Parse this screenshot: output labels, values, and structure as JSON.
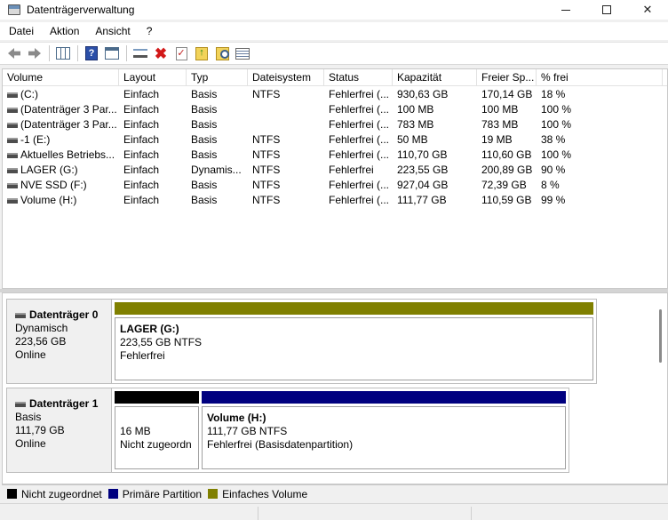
{
  "window": {
    "title": "Datenträgerverwaltung",
    "minimize": "—",
    "maximize": "",
    "close": "✕"
  },
  "menu": [
    "Datei",
    "Aktion",
    "Ansicht",
    "?"
  ],
  "toolbar": {
    "icons": [
      "back-icon",
      "forward-icon",
      "console-tree-icon",
      "help-icon",
      "show-hide-panel-icon",
      "connect-icon",
      "delete-icon",
      "checkmark-icon",
      "up-folder-icon",
      "search-icon",
      "properties-icon"
    ],
    "help_glyph": "?",
    "delete_glyph": "✖",
    "check_glyph": "✓",
    "up_glyph": "↑"
  },
  "volume_table": {
    "columns": [
      "Volume",
      "Layout",
      "Typ",
      "Dateisystem",
      "Status",
      "Kapazität",
      "Freier Sp...",
      "% frei"
    ],
    "rows": [
      [
        "(C:)",
        "Einfach",
        "Basis",
        "NTFS",
        "Fehlerfrei (...",
        "930,63 GB",
        "170,14 GB",
        "18 %"
      ],
      [
        "(Datenträger 3 Par...",
        "Einfach",
        "Basis",
        "",
        "Fehlerfrei (...",
        "100 MB",
        "100 MB",
        "100 %"
      ],
      [
        "(Datenträger 3 Par...",
        "Einfach",
        "Basis",
        "",
        "Fehlerfrei (...",
        "783 MB",
        "783 MB",
        "100 %"
      ],
      [
        "-1 (E:)",
        "Einfach",
        "Basis",
        "NTFS",
        "Fehlerfrei (...",
        "50 MB",
        "19 MB",
        "38 %"
      ],
      [
        "Aktuelles Betriebs...",
        "Einfach",
        "Basis",
        "NTFS",
        "Fehlerfrei (...",
        "110,70 GB",
        "110,60 GB",
        "100 %"
      ],
      [
        "LAGER (G:)",
        "Einfach",
        "Dynamis...",
        "NTFS",
        "Fehlerfrei",
        "223,55 GB",
        "200,89 GB",
        "90 %"
      ],
      [
        "NVE SSD (F:)",
        "Einfach",
        "Basis",
        "NTFS",
        "Fehlerfrei (...",
        "927,04 GB",
        "72,39 GB",
        "8 %"
      ],
      [
        "Volume (H:)",
        "Einfach",
        "Basis",
        "NTFS",
        "Fehlerfrei (...",
        "111,77 GB",
        "110,59 GB",
        "99 %"
      ]
    ]
  },
  "disks": [
    {
      "name": "Datenträger 0",
      "type": "Dynamisch",
      "size": "223,56 GB",
      "state": "Online",
      "partitions": [
        {
          "color": "#808000",
          "name": "LAGER  (G:)",
          "size": "223,55 GB NTFS",
          "status": "Fehlerfrei"
        }
      ]
    },
    {
      "name": "Datenträger 1",
      "type": "Basis",
      "size": "111,79 GB",
      "state": "Online",
      "partitions": [
        {
          "color": "#000000",
          "name": "",
          "size": "16 MB",
          "status": "Nicht zugeordn"
        },
        {
          "color": "#00007f",
          "name": "Volume  (H:)",
          "size": "111,77 GB NTFS",
          "status": "Fehlerfrei (Basisdatenpartition)"
        }
      ]
    }
  ],
  "legend": [
    {
      "color": "#000000",
      "label": "Nicht zugeordnet"
    },
    {
      "color": "#00007f",
      "label": "Primäre Partition"
    },
    {
      "color": "#808000",
      "label": "Einfaches Volume"
    }
  ]
}
